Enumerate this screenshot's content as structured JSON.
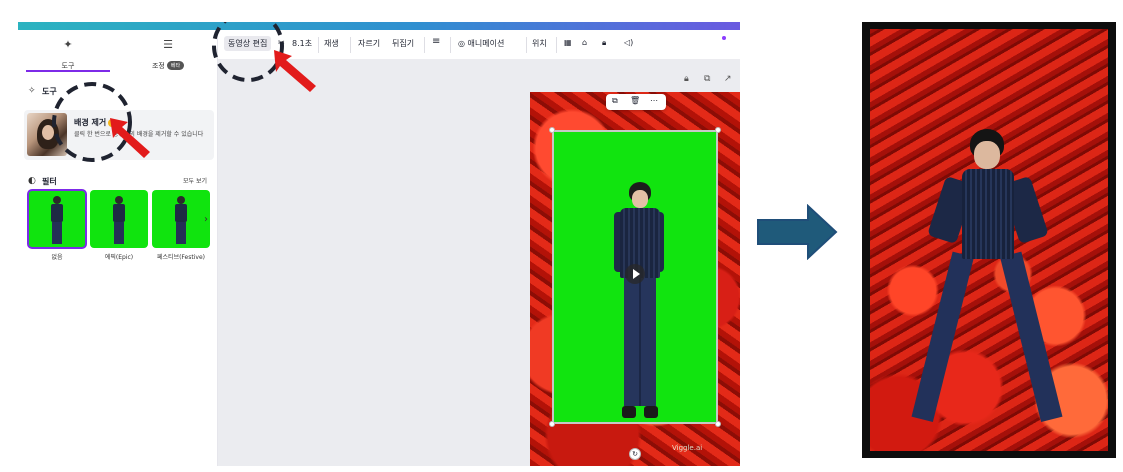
{
  "toolbar": {
    "edit_video": "동영상 편집",
    "duration": "8.1초",
    "playback": "재생",
    "crop": "자르기",
    "flip": "뒤집기",
    "animate": "애니메이션",
    "position": "위치"
  },
  "side_panel": {
    "tab_tools": "도구",
    "tab_adjust": "조정",
    "beta_badge": "베타",
    "tools_heading": "도구",
    "bg_remover": {
      "title": "배경 제거",
      "description": "클릭 한 번으로 동영상의 배경을 제거할 수 있습니다"
    },
    "filters_heading": "필터",
    "see_all": "모두 보기",
    "filters": [
      {
        "label": "없음"
      },
      {
        "label": "에픽(Epic)"
      },
      {
        "label": "페스티브(Festive)"
      }
    ]
  },
  "canvas": {
    "watermark": "Viggle.ai"
  },
  "colors": {
    "accent": "#7d2ae8",
    "green_screen": "#11e40f",
    "annotation_arrow": "#e21b1b",
    "annotation_circle": "#1f2330",
    "flow_arrow": "#1f4e79"
  }
}
